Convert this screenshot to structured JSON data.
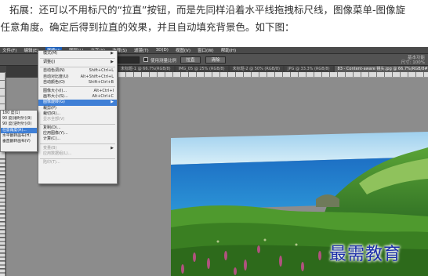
{
  "article": {
    "line1": "拓展：还可以不用标尺的“拉直”按钮，而是先同样沿着水平线拖拽标尺线，图像菜单-图像旋",
    "line2": "-任意角度。确定后得到拉直的效果，并且自动填充背景色。如下图："
  },
  "menubar": {
    "items": [
      "文件(F)",
      "编辑(E)",
      "图像(I)",
      "图层(L)",
      "文字(Y)",
      "选择(S)",
      "滤镜(T)",
      "3D(D)",
      "视图(V)",
      "窗口(W)",
      "帮助(H)"
    ]
  },
  "options": {
    "checkbox_label": "使用测量比例",
    "straighten_button": "拉直",
    "clear_button": "清除",
    "workspace": [
      "基本功能",
      "尺寸: 100%"
    ]
  },
  "tabs": [
    "未标题-1 @ 66.7%(RGB/8)",
    "IMG_05 @ 25% (RGB/8)",
    "未标题-2 @ 50% (RGB/8)",
    "JPG @ 33.3% (RGB/8)",
    "83 - Content-aware 镜头.jpg @ 66.7%(RGB/8#) *"
  ],
  "image_menu": {
    "items": [
      {
        "label": "模式(M)",
        "shortcut": "▶",
        "state": "normal"
      },
      {
        "sep": true
      },
      {
        "label": "调整(J)",
        "shortcut": "▶",
        "state": "normal"
      },
      {
        "sep": true
      },
      {
        "label": "自动色调(N)",
        "shortcut": "Shift+Ctrl+L",
        "state": "normal"
      },
      {
        "label": "自动对比度(U)",
        "shortcut": "Alt+Shift+Ctrl+L",
        "state": "normal"
      },
      {
        "label": "自动颜色(O)",
        "shortcut": "Shift+Ctrl+B",
        "state": "normal"
      },
      {
        "sep": true
      },
      {
        "label": "图像大小(I)...",
        "shortcut": "Alt+Ctrl+I",
        "state": "normal"
      },
      {
        "label": "画布大小(S)...",
        "shortcut": "Alt+Ctrl+C",
        "state": "normal"
      },
      {
        "label": "图像旋转(G)",
        "shortcut": "▶",
        "state": "highlighted"
      },
      {
        "label": "裁剪(P)",
        "shortcut": "",
        "state": "normal"
      },
      {
        "label": "裁切(R)...",
        "shortcut": "",
        "state": "normal"
      },
      {
        "label": "显示全部(V)",
        "shortcut": "",
        "state": "disabled"
      },
      {
        "sep": true
      },
      {
        "label": "复制(D)...",
        "shortcut": "",
        "state": "normal"
      },
      {
        "label": "应用图像(Y)...",
        "shortcut": "",
        "state": "normal"
      },
      {
        "label": "计算(C)...",
        "shortcut": "",
        "state": "normal"
      },
      {
        "sep": true
      },
      {
        "label": "变量(B)",
        "shortcut": "▶",
        "state": "disabled"
      },
      {
        "label": "应用数据组(L)...",
        "shortcut": "",
        "state": "disabled"
      },
      {
        "sep": true
      },
      {
        "label": "陷印(T)...",
        "shortcut": "",
        "state": "disabled"
      }
    ]
  },
  "rotate_submenu": {
    "items": [
      {
        "label": "180 度(1)",
        "state": "normal"
      },
      {
        "label": "90 度(顺时针)(9)",
        "state": "normal"
      },
      {
        "label": "90 度(逆时针)(0)",
        "state": "normal"
      },
      {
        "label": "任意角度(A)...",
        "state": "highlighted"
      },
      {
        "label": "水平翻转画布(H)",
        "state": "normal"
      },
      {
        "label": "垂直翻转画布(V)",
        "state": "normal"
      }
    ]
  },
  "watermark": "最需教育",
  "colors": {
    "menu_bg": "#f0f0f0",
    "highlight": "#3f7fd6",
    "app_dark": "#3a3a3a",
    "watermark": "#1b2ea8"
  }
}
